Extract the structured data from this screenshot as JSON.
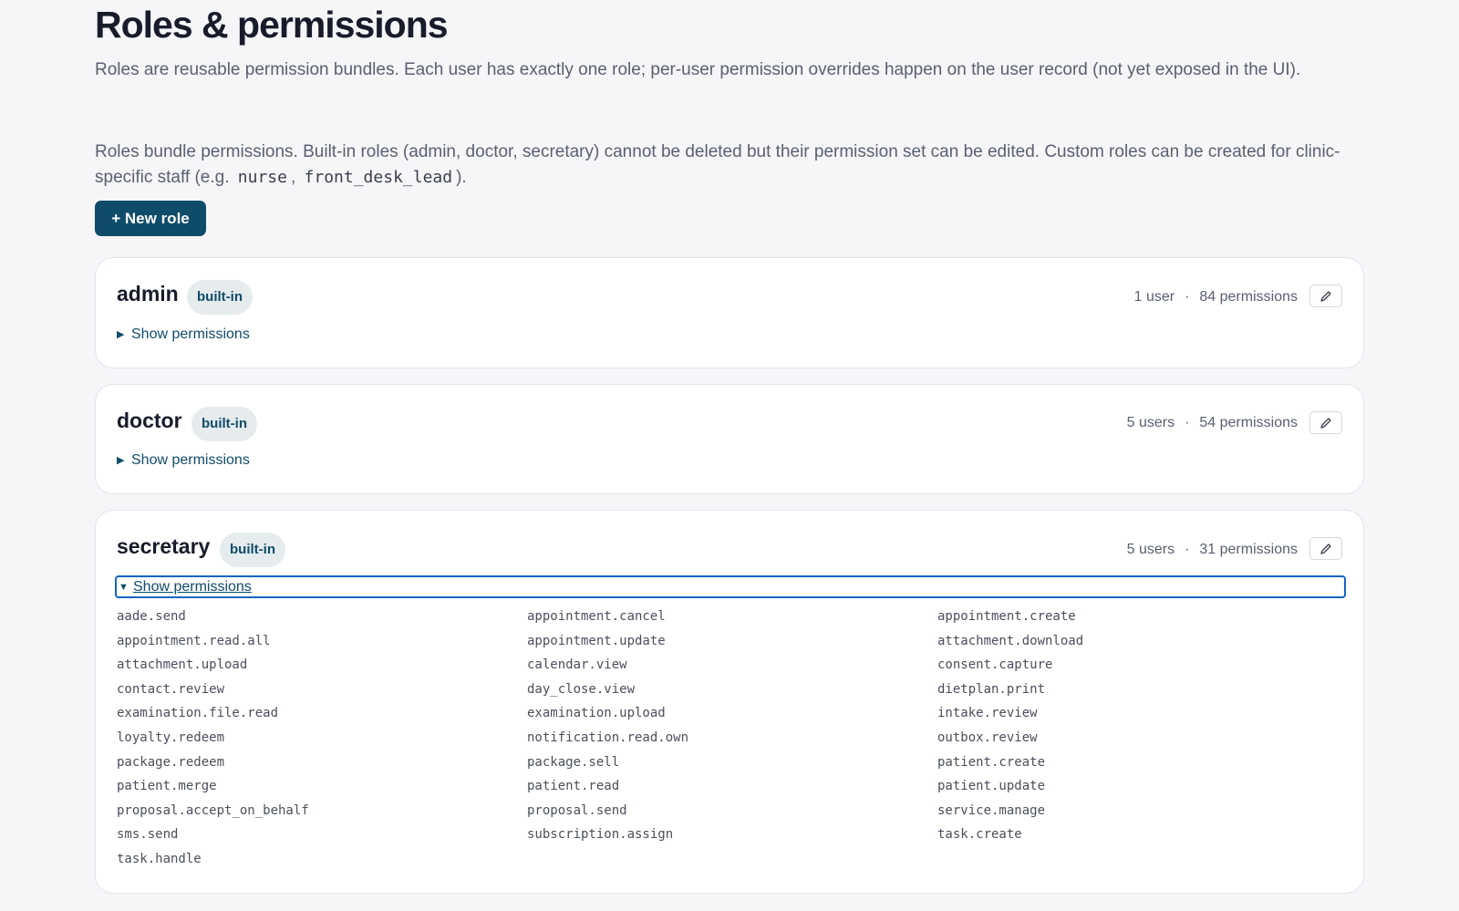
{
  "page": {
    "title": "Roles & permissions",
    "intro": "Roles are reusable permission bundles. Each user has exactly one role; per-user permission overrides happen on the user record (not yet exposed in the UI).",
    "description_before": "Roles bundle permissions. Built-in roles (admin, doctor, secretary) cannot be deleted but their permission set can be edited. Custom roles can be created for clinic-specific staff (e.g.",
    "example_1": "nurse",
    "separator": ",",
    "example_2": "front_desk_lead",
    "description_after": ").",
    "new_role_label": "+ New role"
  },
  "colors": {
    "accent": "#0f4c69",
    "focus_ring": "#1665c0",
    "badge_bg": "#e6ebee",
    "page_bg": "#f6f6f9"
  },
  "roles": [
    {
      "name": "admin",
      "badge": "built-in",
      "users": "1 user",
      "dot": "·",
      "permissions_count": "84 permissions",
      "toggle_label": "Show permissions",
      "expanded": false
    },
    {
      "name": "doctor",
      "badge": "built-in",
      "users": "5 users",
      "dot": "·",
      "permissions_count": "54 permissions",
      "toggle_label": "Show permissions",
      "expanded": false
    },
    {
      "name": "secretary",
      "badge": "built-in",
      "users": "5 users",
      "dot": "·",
      "permissions_count": "31 permissions",
      "toggle_label": "Show permissions",
      "expanded": true,
      "permissions": [
        "aade.send",
        "appointment.cancel",
        "appointment.create",
        "appointment.read.all",
        "appointment.update",
        "attachment.download",
        "attachment.upload",
        "calendar.view",
        "consent.capture",
        "contact.review",
        "day_close.view",
        "dietplan.print",
        "examination.file.read",
        "examination.upload",
        "intake.review",
        "loyalty.redeem",
        "notification.read.own",
        "outbox.review",
        "package.redeem",
        "package.sell",
        "patient.create",
        "patient.merge",
        "patient.read",
        "patient.update",
        "proposal.accept_on_behalf",
        "proposal.send",
        "service.manage",
        "sms.send",
        "subscription.assign",
        "task.create",
        "task.handle"
      ]
    }
  ],
  "icons": {
    "edit": "pencil-icon",
    "collapsed": "caret-right-icon",
    "expanded": "caret-down-icon"
  }
}
